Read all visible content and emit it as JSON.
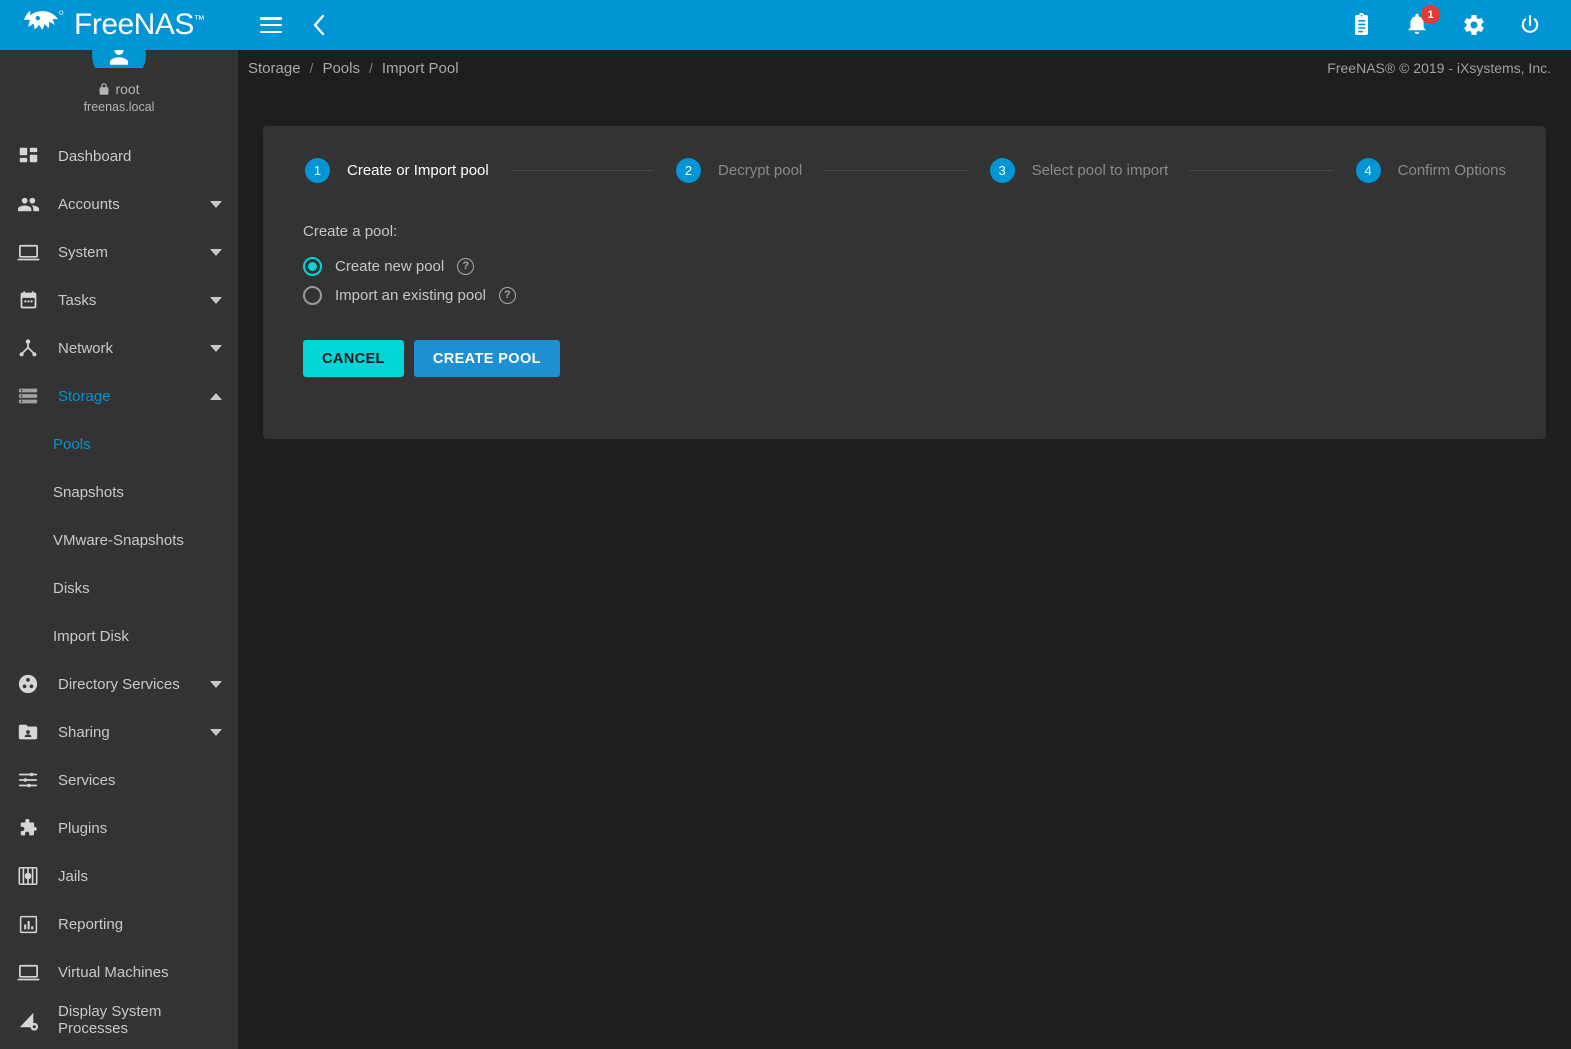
{
  "brand": {
    "name": "FreeNAS",
    "trademark": "™",
    "logo_icon": "freenas-fish-logo"
  },
  "topbar": {
    "menu_icon": "hamburger-menu-icon",
    "collapse_icon": "chevron-left-icon",
    "actions": [
      {
        "icon": "clipboard-icon",
        "name": "jobs-clipboard-button"
      },
      {
        "icon": "bell-icon",
        "name": "notifications-button",
        "badge": "1"
      },
      {
        "icon": "gear-icon",
        "name": "settings-button"
      },
      {
        "icon": "power-icon",
        "name": "power-button"
      }
    ]
  },
  "sidebar": {
    "user": {
      "lock_icon": "lock-icon",
      "username": "root",
      "hostname": "freenas.local"
    },
    "items": [
      {
        "label": "Dashboard",
        "icon": "dashboard-icon",
        "expandable": false,
        "active": false
      },
      {
        "label": "Accounts",
        "icon": "accounts-people-icon",
        "expandable": true,
        "expanded": false,
        "active": false
      },
      {
        "label": "System",
        "icon": "system-monitor-icon",
        "expandable": true,
        "expanded": false,
        "active": false
      },
      {
        "label": "Tasks",
        "icon": "tasks-calendar-icon",
        "expandable": true,
        "expanded": false,
        "active": false
      },
      {
        "label": "Network",
        "icon": "network-icon",
        "expandable": true,
        "expanded": false,
        "active": false
      },
      {
        "label": "Storage",
        "icon": "storage-icon",
        "expandable": true,
        "expanded": true,
        "active": true
      },
      {
        "label": "Directory Services",
        "icon": "directory-services-icon",
        "expandable": true,
        "expanded": false,
        "active": false
      },
      {
        "label": "Sharing",
        "icon": "sharing-folder-icon",
        "expandable": true,
        "expanded": false,
        "active": false
      },
      {
        "label": "Services",
        "icon": "services-sliders-icon",
        "expandable": false,
        "active": false
      },
      {
        "label": "Plugins",
        "icon": "plugins-puzzle-icon",
        "expandable": false,
        "active": false
      },
      {
        "label": "Jails",
        "icon": "jails-icon",
        "expandable": false,
        "active": false
      },
      {
        "label": "Reporting",
        "icon": "reporting-chart-icon",
        "expandable": false,
        "active": false
      },
      {
        "label": "Virtual Machines",
        "icon": "virtual-machines-icon",
        "expandable": false,
        "active": false
      },
      {
        "label": "Display System Processes",
        "icon": "display-system-processes-icon",
        "expandable": false,
        "active": false
      }
    ],
    "storage_submenu": [
      {
        "label": "Pools",
        "active": true
      },
      {
        "label": "Snapshots",
        "active": false
      },
      {
        "label": "VMware-Snapshots",
        "active": false
      },
      {
        "label": "Disks",
        "active": false
      },
      {
        "label": "Import Disk",
        "active": false
      }
    ]
  },
  "breadcrumb": {
    "items": [
      "Storage",
      "Pools",
      "Import Pool"
    ],
    "separator": "/"
  },
  "footer": {
    "copyright": "FreeNAS® © 2019 - iXsystems, Inc."
  },
  "wizard": {
    "steps": [
      {
        "number": "1",
        "label": "Create or Import pool",
        "state": "active"
      },
      {
        "number": "2",
        "label": "Decrypt pool",
        "state": "inactive"
      },
      {
        "number": "3",
        "label": "Select pool to import",
        "state": "inactive"
      },
      {
        "number": "4",
        "label": "Confirm Options",
        "state": "inactive"
      }
    ],
    "form": {
      "title": "Create a pool:",
      "options": [
        {
          "label": "Create new pool",
          "selected": true,
          "help_icon": "help-circle-icon"
        },
        {
          "label": "Import an existing pool",
          "selected": false,
          "help_icon": "help-circle-icon"
        }
      ]
    },
    "buttons": {
      "cancel": "CANCEL",
      "create": "CREATE POOL"
    }
  },
  "colors": {
    "brand_blue": "#0095d5",
    "accent_cyan": "#00d5d7",
    "primary_button": "#1e90d2",
    "sidebar_bg": "#333333",
    "page_bg": "#1e1e1e",
    "badge_red": "#e53935"
  }
}
